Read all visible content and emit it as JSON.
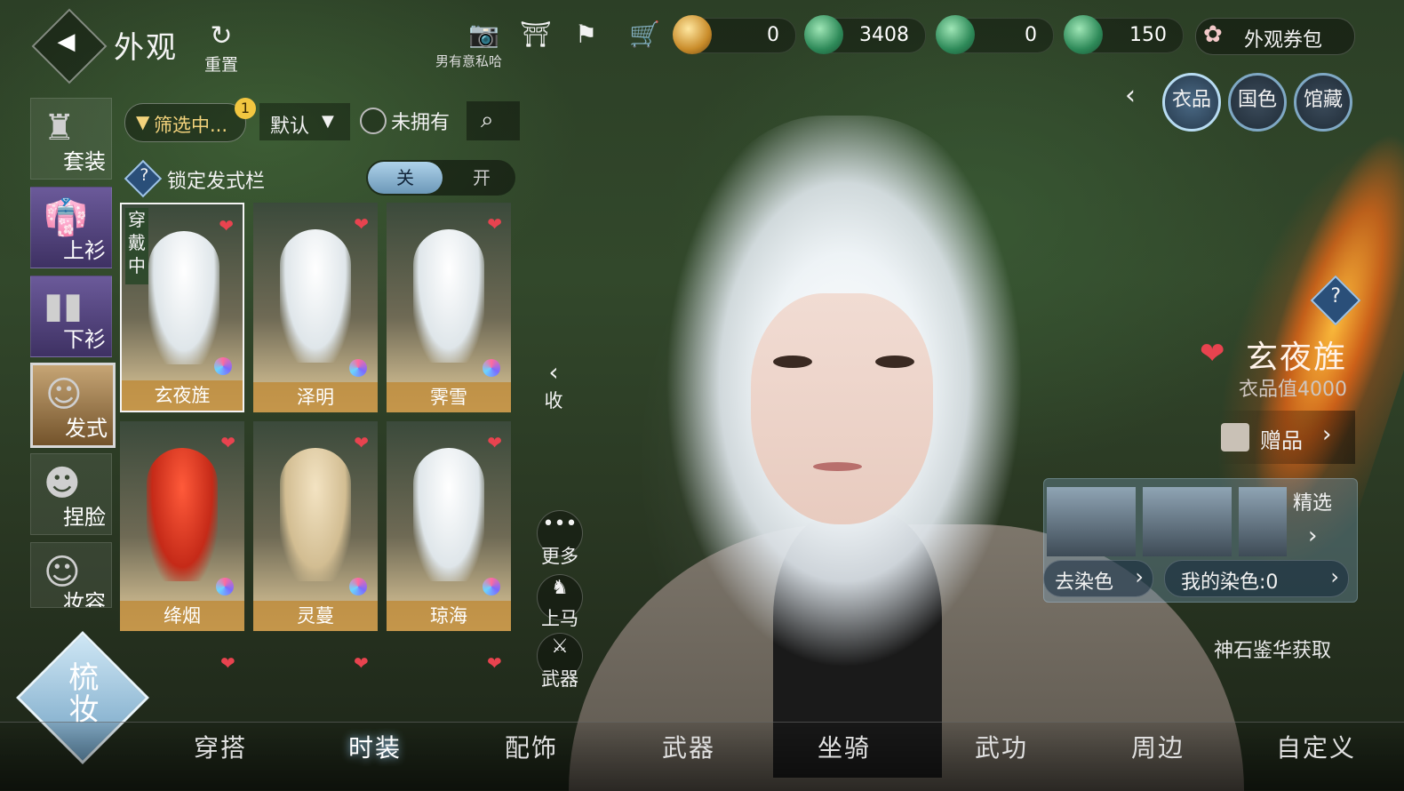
{
  "header": {
    "title": "外观",
    "reset_label": "重置",
    "caption": "男有意私哈",
    "pack_label": "外观券包",
    "currencies": [
      {
        "name": "gold-coin",
        "value": "0"
      },
      {
        "name": "jade-coin-1",
        "value": "3408"
      },
      {
        "name": "jade-coin-2",
        "value": "0"
      },
      {
        "name": "jade-coin-3",
        "value": "150"
      }
    ]
  },
  "right_tabs": [
    "衣品",
    "国色",
    "馆藏"
  ],
  "selected_item": {
    "name": "玄夜旌",
    "value_label": "衣品值4000",
    "gift_label": "赠品",
    "featured_label": "精选",
    "remove_dye_label": "去染色",
    "my_dye_label": "我的染色:0",
    "obtain_label": "神石鉴华获取"
  },
  "left_categories": [
    "套装",
    "上衫",
    "下衫",
    "发式",
    "捏脸",
    "妆容"
  ],
  "filter": {
    "filter_label": "筛选中...",
    "badge": "1",
    "sort_label": "默认",
    "not_owned_label": "未拥有"
  },
  "lock": {
    "label": "锁定发式栏",
    "off_label": "关",
    "on_label": "开"
  },
  "hairstyles": [
    {
      "name": "玄夜旌",
      "wearing": "穿戴中"
    },
    {
      "name": "泽明",
      "wearing": ""
    },
    {
      "name": "霁雪",
      "wearing": ""
    },
    {
      "name": "绛烟",
      "wearing": ""
    },
    {
      "name": "灵蔓",
      "wearing": ""
    },
    {
      "name": "琼海",
      "wearing": ""
    }
  ],
  "side_actions": {
    "collapse": "收",
    "more": "更多",
    "mount": "上马",
    "weapon": "武器"
  },
  "comb_label": "梳妆",
  "bottom_nav": [
    "穿搭",
    "时装",
    "配饰",
    "武器",
    "坐骑",
    "武功",
    "周边",
    "自定义"
  ],
  "colors": {
    "accent_blue": "#9fc3e6",
    "heart_red": "#e8434f",
    "name_bar_gold": "#be8c3c"
  }
}
